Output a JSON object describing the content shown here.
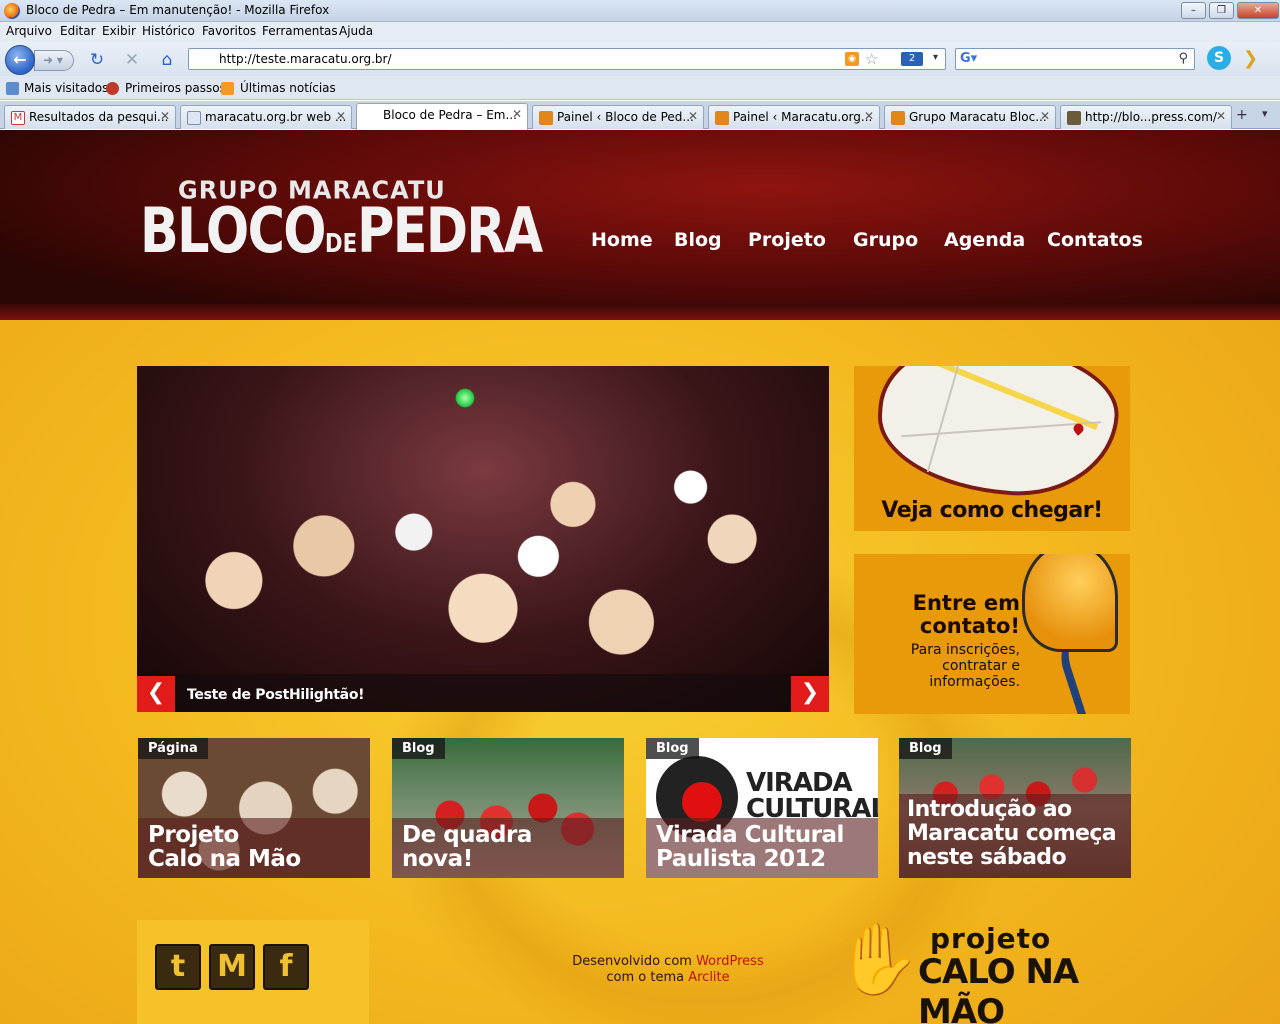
{
  "window": {
    "title": "Bloco de Pedra – Em manutenção! - Mozilla Firefox"
  },
  "menu": [
    "Arquivo",
    "Editar",
    "Exibir",
    "Histórico",
    "Favoritos",
    "Ferramentas",
    "Ajuda"
  ],
  "navbar": {
    "url": "http://teste.maracatu.org.br/",
    "badge": "2",
    "search_placeholder": ""
  },
  "bookmarks": [
    "Mais visitados",
    "Primeiros passos",
    "Últimas notícias"
  ],
  "tabs": [
    {
      "label": "Resultados da pesqui...",
      "active": false
    },
    {
      "label": "maracatu.org.br web ...",
      "active": false
    },
    {
      "label": "Bloco de Pedra – Em...",
      "active": true
    },
    {
      "label": "Painel ‹ Bloco de Ped...",
      "active": false
    },
    {
      "label": "Painel ‹ Maracatu.org...",
      "active": false
    },
    {
      "label": "Grupo Maracatu Bloc...",
      "active": false
    },
    {
      "label": "http://blo...press.com/",
      "active": false
    }
  ],
  "site": {
    "logo_top": "GRUPO MARACATU",
    "logo_bloco": "BLOCO",
    "logo_de": "DE",
    "logo_pedra": "PEDRA",
    "nav": [
      "Home",
      "Blog",
      "Projeto",
      "Grupo",
      "Agenda",
      "Contatos"
    ],
    "slider_caption": "Teste de PostHilightão!",
    "map_label": "Veja como chegar!",
    "contact_title_1": "Entre em",
    "contact_title_2": "contato!",
    "contact_sub_1": "Para inscrições,",
    "contact_sub_2": "contratar e",
    "contact_sub_3": "informações.",
    "posts": [
      {
        "tag": "Página",
        "line1": "Projeto",
        "line2": "Calo na Mão",
        "line3": ""
      },
      {
        "tag": "Blog",
        "line1": "De quadra",
        "line2": "nova!",
        "line3": ""
      },
      {
        "tag": "Blog",
        "line1": "Virada Cultural",
        "line2": "Paulista 2012",
        "line3": ""
      },
      {
        "tag": "Blog",
        "line1": "Introdução ao",
        "line2": "Maracatu começa",
        "line3": "neste sábado"
      }
    ],
    "credits_prefix": "Desenvolvido com",
    "credits_wp": "WordPress",
    "credits_theme_prefix": "com o tema",
    "credits_theme": "Arclite",
    "calo_line1": "projeto",
    "calo_line2": "CALO NA MÃO",
    "virada_logo_1": "VIRADA",
    "virada_logo_2": "CULTURAL"
  },
  "colors": {
    "accent_red": "#e21b1b",
    "header_red": "#8e1410",
    "page_yellow": "#f3b81e",
    "box_orange": "#e89a0a"
  }
}
